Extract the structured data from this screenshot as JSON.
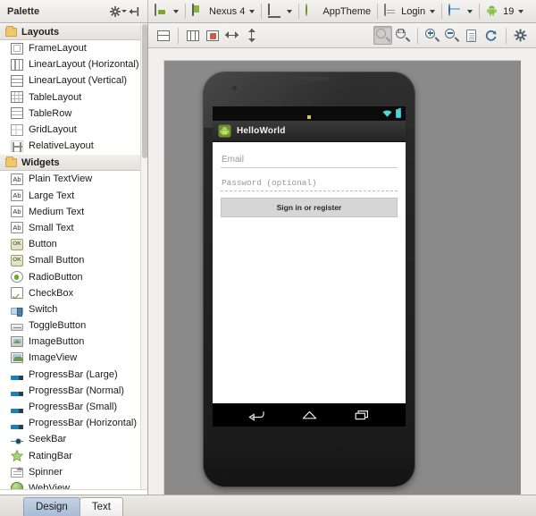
{
  "window": {
    "palette_title": "Palette"
  },
  "palette_header": {
    "gear_icon": "gear-icon",
    "collapse_icon": "collapse-panel-icon"
  },
  "toolbar": {
    "items": [
      {
        "id": "device-config",
        "label": "",
        "icon": "device-config-icon",
        "caret": true
      },
      {
        "id": "device",
        "label": "Nexus 4",
        "icon": "device-icon",
        "caret": true
      },
      {
        "id": "orientation",
        "label": "",
        "icon": "orientation-icon",
        "caret": true
      },
      {
        "id": "theme",
        "label": "AppTheme",
        "icon": "theme-icon",
        "caret": true
      },
      {
        "id": "activity",
        "label": "Login",
        "icon": "activity-icon",
        "caret": true
      },
      {
        "id": "locale",
        "label": "",
        "icon": "globe-icon",
        "caret": true
      },
      {
        "id": "api-level",
        "label": "19",
        "icon": "android-icon",
        "caret": true
      }
    ]
  },
  "canvas_toolbar": {
    "left_buttons": [
      {
        "id": "show-layout-decorations",
        "icon": "rows-icon"
      },
      {
        "id": "show-included",
        "icon": "columns-icon"
      },
      {
        "id": "render-errors",
        "icon": "render-error-icon"
      },
      {
        "id": "toggle-width",
        "icon": "horizontal-resize-icon"
      },
      {
        "id": "toggle-height",
        "icon": "vertical-resize-icon"
      }
    ],
    "right_buttons": [
      {
        "id": "zoom-fit",
        "icon": "zoom-fit-icon",
        "pressed": true
      },
      {
        "id": "zoom-actual",
        "icon": "zoom-actual-size-icon",
        "pressed": false
      },
      {
        "id": "zoom-in",
        "icon": "zoom-in-icon",
        "pressed": false
      },
      {
        "id": "zoom-out",
        "icon": "zoom-out-icon",
        "pressed": false
      },
      {
        "id": "save-screenshot",
        "icon": "document-icon",
        "pressed": false
      },
      {
        "id": "refresh",
        "icon": "refresh-icon",
        "pressed": false
      },
      {
        "id": "settings",
        "icon": "gear-icon",
        "pressed": false
      }
    ]
  },
  "palette": {
    "groups": [
      {
        "title": "Layouts",
        "icon": "folder-icon",
        "items": [
          {
            "label": "FrameLayout",
            "icon": "frame-layout-icon"
          },
          {
            "label": "LinearLayout (Horizontal)",
            "icon": "linear-layout-horizontal-icon"
          },
          {
            "label": "LinearLayout (Vertical)",
            "icon": "linear-layout-vertical-icon"
          },
          {
            "label": "TableLayout",
            "icon": "table-layout-icon"
          },
          {
            "label": "TableRow",
            "icon": "table-row-icon"
          },
          {
            "label": "GridLayout",
            "icon": "grid-layout-icon"
          },
          {
            "label": "RelativeLayout",
            "icon": "relative-layout-icon"
          }
        ]
      },
      {
        "title": "Widgets",
        "icon": "folder-icon",
        "items": [
          {
            "label": "Plain TextView",
            "icon": "text-ab-icon"
          },
          {
            "label": "Large Text",
            "icon": "text-ab-icon"
          },
          {
            "label": "Medium Text",
            "icon": "text-ab-icon"
          },
          {
            "label": "Small Text",
            "icon": "text-ab-icon"
          },
          {
            "label": "Button",
            "icon": "button-ok-icon"
          },
          {
            "label": "Small Button",
            "icon": "button-ok-icon"
          },
          {
            "label": "RadioButton",
            "icon": "radio-button-icon"
          },
          {
            "label": "CheckBox",
            "icon": "checkbox-icon"
          },
          {
            "label": "Switch",
            "icon": "switch-icon"
          },
          {
            "label": "ToggleButton",
            "icon": "toggle-button-icon"
          },
          {
            "label": "ImageButton",
            "icon": "image-button-icon"
          },
          {
            "label": "ImageView",
            "icon": "image-view-icon"
          },
          {
            "label": "ProgressBar (Large)",
            "icon": "progress-bar-icon"
          },
          {
            "label": "ProgressBar (Normal)",
            "icon": "progress-bar-icon"
          },
          {
            "label": "ProgressBar (Small)",
            "icon": "progress-bar-icon"
          },
          {
            "label": "ProgressBar (Horizontal)",
            "icon": "progress-bar-icon"
          },
          {
            "label": "SeekBar",
            "icon": "seek-bar-icon"
          },
          {
            "label": "RatingBar",
            "icon": "rating-bar-icon"
          },
          {
            "label": "Spinner",
            "icon": "spinner-icon"
          },
          {
            "label": "WebView",
            "icon": "web-view-icon"
          }
        ]
      }
    ]
  },
  "preview": {
    "device_skin": "nexus-4",
    "status_bar": {
      "wifi_icon": "wifi-icon",
      "battery_icon": "battery-icon"
    },
    "action_bar": {
      "app_icon": "android-app-icon",
      "title": "HelloWorld"
    },
    "form": {
      "email_placeholder": "Email",
      "password_placeholder": "Password (optional)",
      "submit_label": "Sign in or register"
    },
    "nav_bar": {
      "back_icon": "back-icon",
      "home_icon": "home-icon",
      "recents_icon": "recents-icon"
    }
  },
  "bottom_tabs": {
    "tabs": [
      {
        "label": "Design",
        "active": true
      },
      {
        "label": "Text",
        "active": false
      }
    ]
  },
  "colors": {
    "accent_green": "#7aa72b",
    "selection_blue": "#a8bcd6",
    "canvas_gray": "#8a8a8a",
    "status_cyan": "#4fd6d6"
  }
}
